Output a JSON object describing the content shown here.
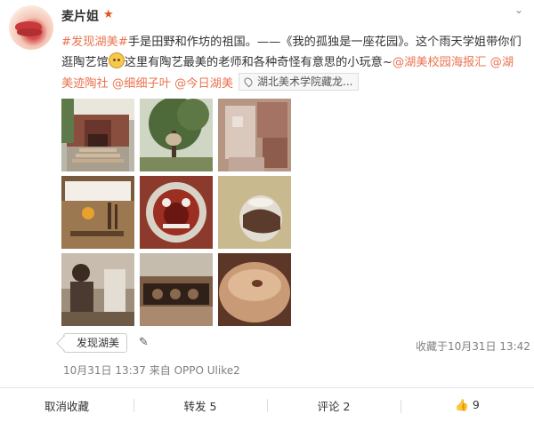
{
  "post": {
    "username": "麦片姐",
    "vip_icon": "vip-star-icon",
    "dropdown_icon": "chevron-down-icon",
    "text_parts": [
      {
        "text": "#发现湖美#",
        "type": "topic"
      },
      {
        "text": "手是田野和作坊的祖国。——《我的孤独是一座花园》。这个雨天学姐带你们逛陶艺馆",
        "type": "plain"
      },
      {
        "text": "这里有陶艺最美的老师和各种奇怪有意思的小玩意~",
        "type": "plain"
      },
      {
        "text": "@湖美校园海报汇",
        "type": "mention"
      },
      {
        "text": "@湖美迹陶社",
        "type": "mention"
      },
      {
        "text": "@细细子叶",
        "type": "mention"
      },
      {
        "text": "@今日湖美",
        "type": "mention"
      }
    ],
    "location": "湖北美术学院藏龙...",
    "tag": "发现湖美",
    "favorite_time": "收藏于10月31日 13:42",
    "meta": "10月31日 13:37 来自 OPPO Ulike2"
  },
  "actions": {
    "unfavorite": "取消收藏",
    "repost": "转发 5",
    "comment": "评论 2",
    "like": "9"
  },
  "colors": {
    "accent": "#eb7350",
    "text": "#333333",
    "meta": "#808080"
  }
}
